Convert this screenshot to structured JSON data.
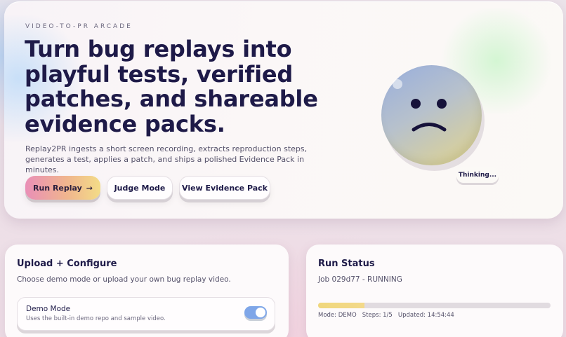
{
  "hero": {
    "eyebrow": "VIDEO-TO-PR ARCADE",
    "headline": "Turn bug replays into playful tests, verified patches, and shareable evidence packs.",
    "subtext": "Replay2PR ingests a short screen recording, extracts reproduction steps, generates a test, applies a patch, and ships a polished Evidence Pack in minutes.",
    "buttons": {
      "run_replay": "Run Replay",
      "run_replay_icon": "arrow-right-icon",
      "judge_mode": "Judge Mode",
      "view_evidence": "View Evidence Pack"
    },
    "mascot": {
      "mood": "sad-face",
      "bubble": "Thinking..."
    }
  },
  "upload": {
    "title": "Upload + Configure",
    "description": "Choose demo mode or upload your own bug replay video.",
    "demo_mode": {
      "label": "Demo Mode",
      "description": "Uses the built-in demo repo and sample video.",
      "enabled": true
    }
  },
  "status": {
    "title": "Run Status",
    "job": "Job 029d77 - RUNNING",
    "progress": 0.2,
    "mode": "Mode: DEMO",
    "steps": "Steps: 1/5",
    "updated": "Updated: 14:54:44"
  },
  "colors": {
    "ink": "#1e1a48",
    "accent_blue": "#7fa6e8",
    "progress_yellow": "#f0d77c",
    "primary_gradient_start": "#e98fb7",
    "primary_gradient_end": "#f3dc87"
  }
}
